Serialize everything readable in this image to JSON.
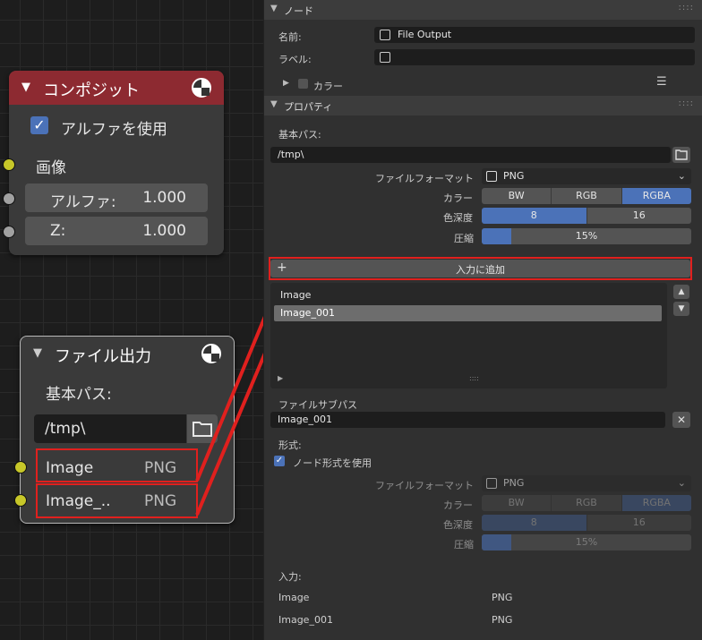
{
  "composite_node": {
    "title": "コンポジット",
    "use_alpha_label": "アルファを使用",
    "image_label": "画像",
    "alpha_label": "アルファ:",
    "alpha_value": "1.000",
    "z_label": "Z:",
    "z_value": "1.000",
    "header_color": "#8d2a31"
  },
  "file_output_node": {
    "title": "ファイル出力",
    "base_path_label": "基本パス:",
    "base_path_value": "/tmp\\",
    "inputs": [
      {
        "name": "Image",
        "format": "PNG"
      },
      {
        "name": "Image_..",
        "format": "PNG"
      }
    ]
  },
  "properties": {
    "node_section": {
      "title": "ノード",
      "name_label": "名前:",
      "name_value": "File Output",
      "label_label": "ラベル:",
      "label_value": "",
      "color_label": "カラー"
    },
    "props_section": {
      "title": "プロパティ",
      "base_path_label": "基本パス:",
      "base_path_value": "/tmp\\",
      "file_format_label": "ファイルフォーマット",
      "file_format_value": "PNG",
      "color_label": "カラー",
      "color_options": [
        "BW",
        "RGB",
        "RGBA"
      ],
      "color_selected": "RGBA",
      "depth_label": "色深度",
      "depth_options": [
        "8",
        "16"
      ],
      "depth_selected": "8",
      "compression_label": "圧縮",
      "compression_value": "15%",
      "compression_fraction": 0.15,
      "add_input_label": "入力に追加",
      "input_list": [
        "Image",
        "Image_001"
      ],
      "selected_input": "Image_001",
      "sub_path_label": "ファイルサブパス",
      "sub_path_value": "Image_001",
      "format_label": "形式:",
      "use_node_format_label": "ノード形式を使用",
      "input_header": "入力:",
      "input_rows": [
        {
          "name": "Image",
          "format": "PNG"
        },
        {
          "name": "Image_001",
          "format": "PNG"
        }
      ]
    },
    "accent_color": "#4b72b8",
    "highlight_color": "#e0201e"
  }
}
